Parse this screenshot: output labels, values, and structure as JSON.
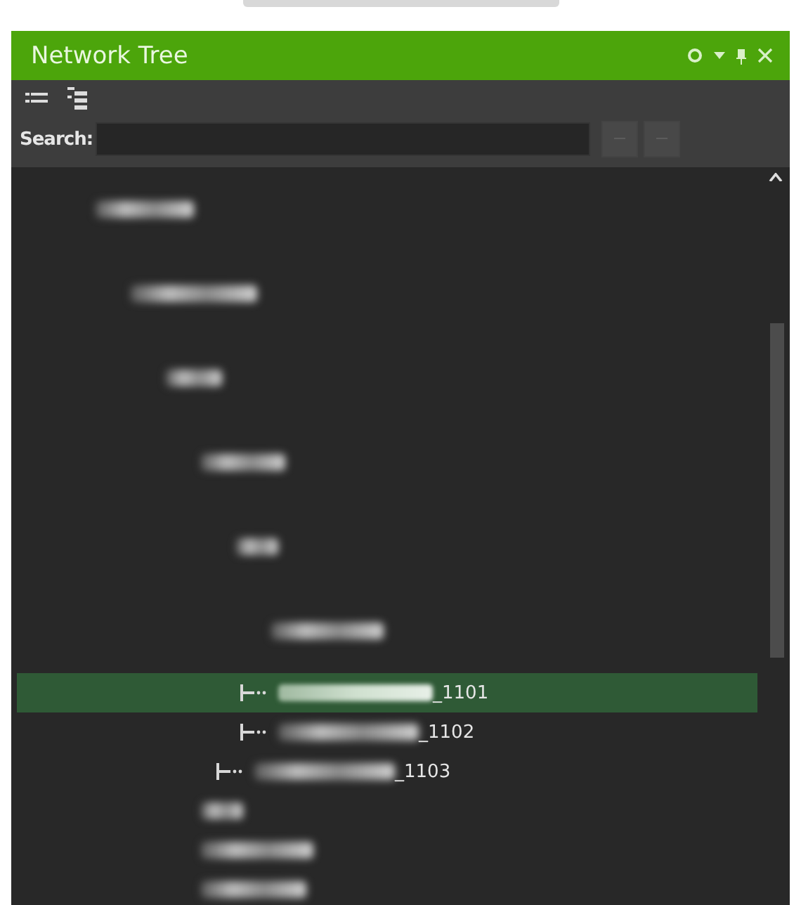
{
  "window": {
    "title": "Network Tree"
  },
  "search": {
    "label": "Search:"
  },
  "tree": {
    "items": [
      {
        "kind": "blurred",
        "selected": false,
        "children": [
          {
            "kind": "blurred",
            "selected": false,
            "children": [
              {
                "kind": "blurred",
                "selected": false,
                "children": [
                  {
                    "kind": "blurred",
                    "selected": false,
                    "children": [
                      {
                        "kind": "blurred",
                        "selected": false,
                        "children": [
                          {
                            "kind": "blurred",
                            "selected": false,
                            "children": [
                              {
                                "kind": "port",
                                "label": "_1101",
                                "selected": true
                              },
                              {
                                "kind": "port",
                                "label": "_1102",
                                "selected": false
                              }
                            ]
                          },
                          {
                            "kind": "port",
                            "label": "_1103",
                            "selected": false
                          }
                        ]
                      }
                    ]
                  },
                  {
                    "kind": "blurred",
                    "selected": false
                  },
                  {
                    "kind": "blurred",
                    "selected": false
                  },
                  {
                    "kind": "blurred",
                    "selected": false
                  }
                ]
              }
            ]
          }
        ]
      }
    ]
  }
}
